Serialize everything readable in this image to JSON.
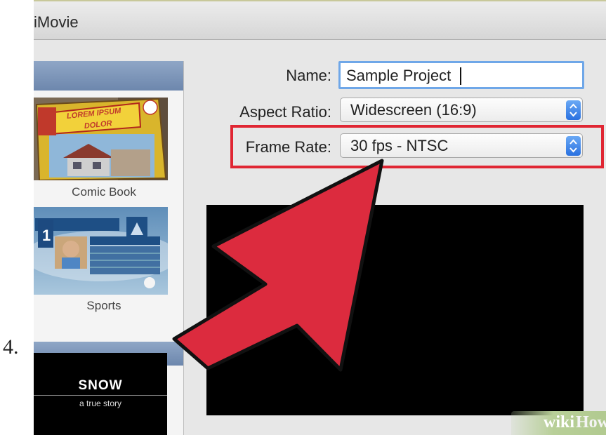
{
  "step_number": "4.",
  "window": {
    "title": "iMovie"
  },
  "themes": [
    {
      "label": "Comic Book",
      "art_text": "LOREM IPSUM DOLOR"
    },
    {
      "label": "Sports"
    },
    {
      "label": "SNOW",
      "subtitle": "a true story"
    }
  ],
  "form": {
    "name_label": "Name:",
    "name_value": "Sample Project",
    "aspect_label": "Aspect Ratio:",
    "aspect_value": "Widescreen (16:9)",
    "framerate_label": "Frame Rate:",
    "framerate_value": "30 fps - NTSC"
  },
  "annotation": {
    "highlight_color": "#e02633",
    "arrow_color": "#dc2b3e"
  },
  "watermark": {
    "part1": "wiki",
    "part2": "How"
  }
}
